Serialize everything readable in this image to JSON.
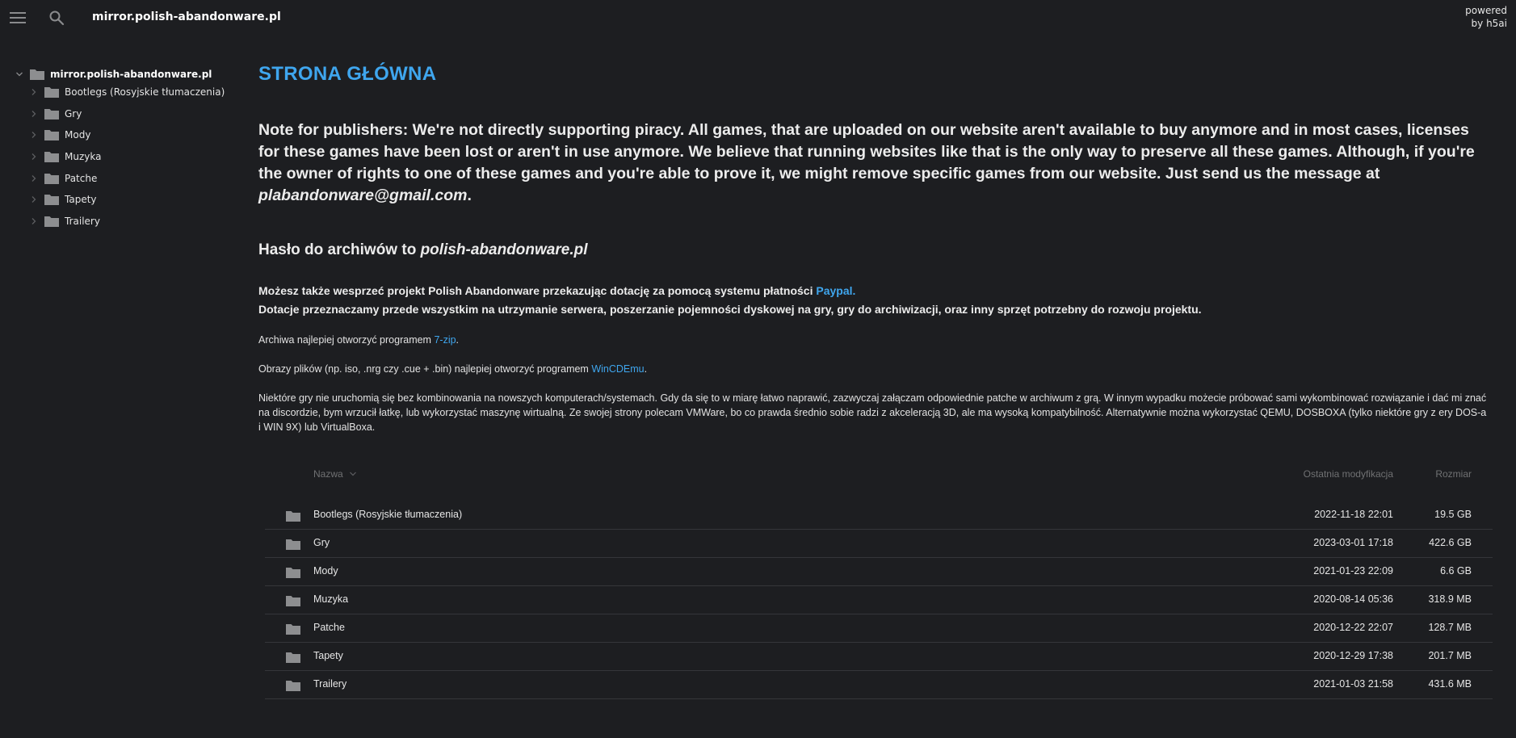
{
  "topbar": {
    "crumb_root": "mirror.polish-abandonware.pl",
    "powered_line1": "powered",
    "powered_line2": "by h5ai"
  },
  "sidebar": {
    "root": "mirror.polish-abandonware.pl",
    "items": [
      {
        "label": "Bootlegs (Rosyjskie tłumaczenia)"
      },
      {
        "label": "Gry"
      },
      {
        "label": "Mody"
      },
      {
        "label": "Muzyka"
      },
      {
        "label": "Patche"
      },
      {
        "label": "Tapety"
      },
      {
        "label": "Trailery"
      }
    ]
  },
  "content": {
    "title": "STRONA GŁÓWNA",
    "note_text": "Note for publishers: We're not directly supporting piracy. All games, that are uploaded on our website aren't available to buy anymore and in most cases, licenses for these games have been lost or aren't in use anymore. We believe that running websites like that is the only way to preserve all these games. Although, if you're the owner of rights to one of these games and you're able to prove it, we might remove specific games from our website. Just send us the message at ",
    "note_email": "plabandonware@gmail.com",
    "note_end": ".",
    "password_prefix": "Hasło do archiwów to ",
    "password_value": "polish-abandonware.pl",
    "support_line1": "Możesz także wesprzeć projekt Polish Abandonware przekazując dotację za pomocą systemu płatności ",
    "support_link": "Paypal.",
    "support_line2": "Dotacje przeznaczamy przede wszystkim na utrzymanie serwera, poszerzanie pojemności dyskowej na gry, gry do archiwizacji, oraz inny sprzęt potrzebny do rozwoju projektu.",
    "tip_7zip_prefix": "Archiwa najlepiej otworzyć programem ",
    "tip_7zip_link": "7-zip",
    "tip_7zip_end": ".",
    "tip_wincd_prefix": "Obrazy plików (np. iso, .nrg czy .cue + .bin) najlepiej otworzyć programem ",
    "tip_wincd_link": "WinCDEmu",
    "tip_wincd_end": ".",
    "tip_compat": "Niektóre gry nie uruchomią się bez kombinowania na nowszych komputerach/systemach. Gdy da się to w miarę łatwo naprawić, zazwyczaj załączam odpowiednie patche w archiwum z grą. W innym wypadku możecie próbować sami wykombinować rozwiązanie i dać mi znać na discordzie, bym wrzucił łatkę, lub wykorzystać maszynę wirtualną. Ze swojej strony polecam VMWare, bo co prawda średnio sobie radzi z akceleracją 3D, ale ma wysoką kompatybilność. Alternatywnie można wykorzystać QEMU, DOSBOXA (tylko niektóre gry z ery DOS-a i WIN 9X) lub VirtualBoxa."
  },
  "table": {
    "headers": {
      "name": "Nazwa",
      "date": "Ostatnia modyfikacja",
      "size": "Rozmiar"
    },
    "rows": [
      {
        "name": "Bootlegs (Rosyjskie tłumaczenia)",
        "date": "2022-11-18 22:01",
        "size": "19.5 GB"
      },
      {
        "name": "Gry",
        "date": "2023-03-01 17:18",
        "size": "422.6 GB"
      },
      {
        "name": "Mody",
        "date": "2021-01-23 22:09",
        "size": "6.6 GB"
      },
      {
        "name": "Muzyka",
        "date": "2020-08-14 05:36",
        "size": "318.9 MB"
      },
      {
        "name": "Patche",
        "date": "2020-12-22 22:07",
        "size": "128.7 MB"
      },
      {
        "name": "Tapety",
        "date": "2020-12-29 17:38",
        "size": "201.7 MB"
      },
      {
        "name": "Trailery",
        "date": "2021-01-03 21:58",
        "size": "431.6 MB"
      }
    ]
  },
  "colors": {
    "background": "#1d1e21",
    "accent": "#3fa6ee",
    "folder": "#8d8e90",
    "divider": "#35363a"
  },
  "icons": [
    "menu-icon",
    "search-icon",
    "folder-icon",
    "chevron-right-icon",
    "chevron-down-icon",
    "sort-chevron-down-icon"
  ]
}
